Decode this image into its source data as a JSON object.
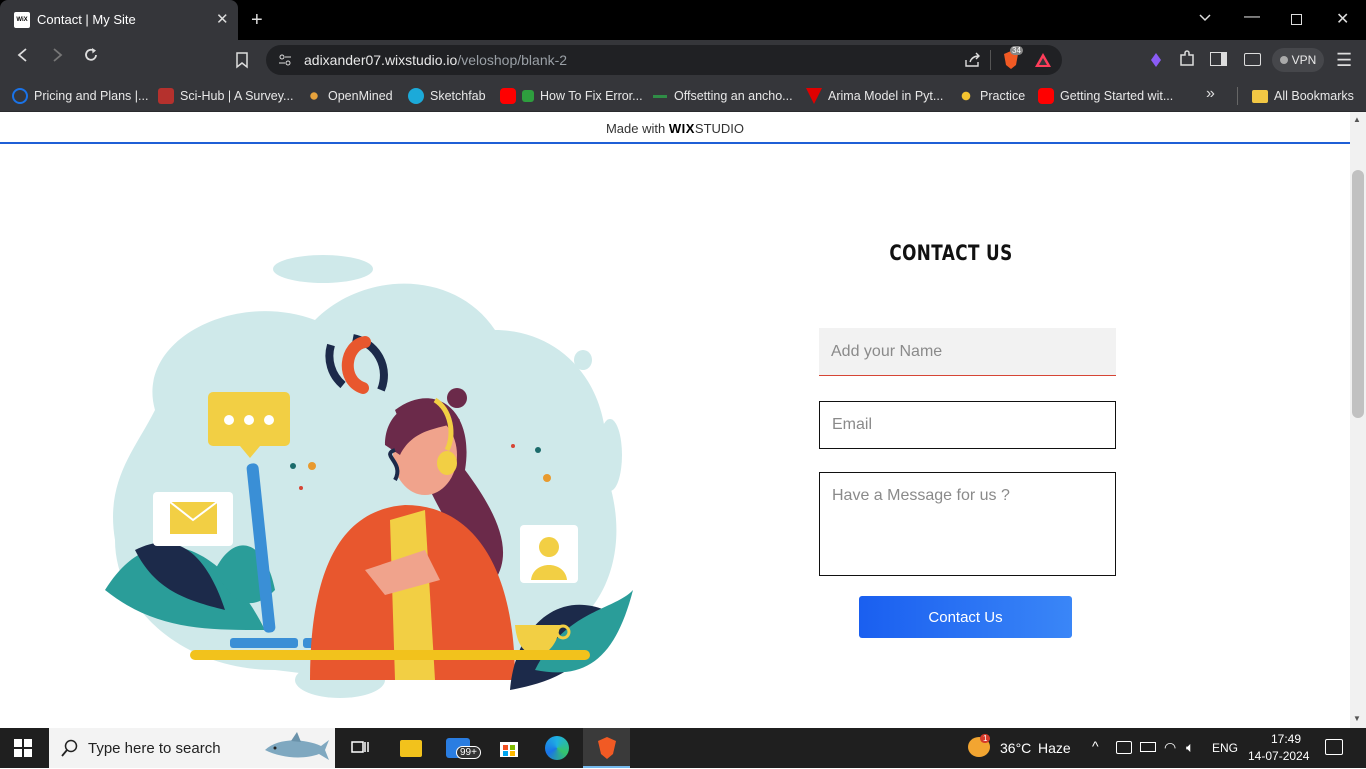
{
  "browser": {
    "tab_title": "Contact | My Site",
    "favicon_text": "WiX",
    "url_host": "adixander07.wixstudio.io",
    "url_path": "/veloshop/blank-2",
    "brave_badge": "34",
    "vpn_label": "VPN"
  },
  "bookmarks": [
    {
      "label": "Pricing and Plans |...",
      "color": "#1a73e8"
    },
    {
      "label": "Sci-Hub | A Survey...",
      "color": "#b5312d"
    },
    {
      "label": "OpenMined",
      "color": "#e6a23c"
    },
    {
      "label": "Sketchfab",
      "color": "#1caad9"
    },
    {
      "label": "How To Fix Error...",
      "color": "#ff0000"
    },
    {
      "label": "Offsetting an ancho...",
      "color": "#2f8d46"
    },
    {
      "label": "Arima Model in Pyt...",
      "color": "#e00000"
    },
    {
      "label": "Practice",
      "color": "#f4c430"
    },
    {
      "label": "Getting Started wit...",
      "color": "#ff0000"
    }
  ],
  "bookmarks_all": "All Bookmarks",
  "page": {
    "made_with_prefix": "Made with",
    "made_with_brand_bold": "WIX",
    "made_with_brand": "STUDIO",
    "contact_title": "CONTACT US",
    "name_placeholder": "Add your Name",
    "email_placeholder": "Email",
    "message_placeholder": "Have a Message for us ?",
    "submit_label": "Contact Us"
  },
  "taskbar": {
    "search_placeholder": "Type here to search",
    "mail_badge": "99+",
    "weather_temp": "36°C",
    "weather_desc": "Haze",
    "weather_alert": "1",
    "language": "ENG",
    "time": "17:49",
    "date": "14-07-2024"
  }
}
